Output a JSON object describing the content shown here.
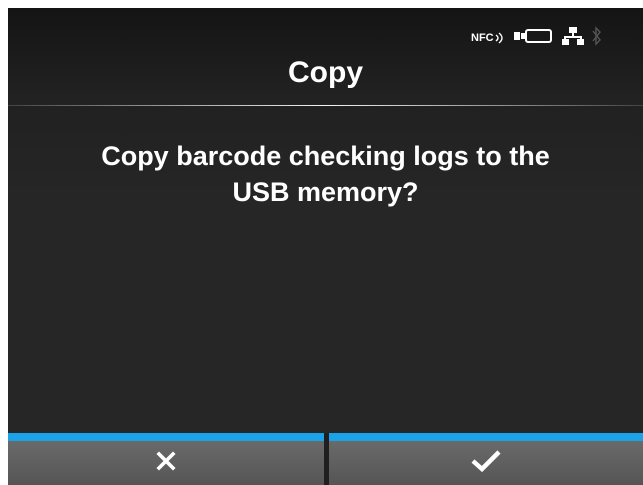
{
  "screen": {
    "title": "Copy",
    "message_line1": "Copy barcode checking logs to the",
    "message_line2": "USB memory?"
  },
  "status_bar": {
    "nfc_label": "NFC",
    "icons": [
      "nfc-icon",
      "battery-icon",
      "network-icon",
      "bluetooth-icon"
    ]
  },
  "buttons": {
    "cancel_icon": "close-icon",
    "confirm_icon": "checkmark-icon"
  },
  "colors": {
    "accent": "#1aa3e8",
    "background": "#262626",
    "button": "#5f5f5f",
    "text": "#ffffff"
  }
}
